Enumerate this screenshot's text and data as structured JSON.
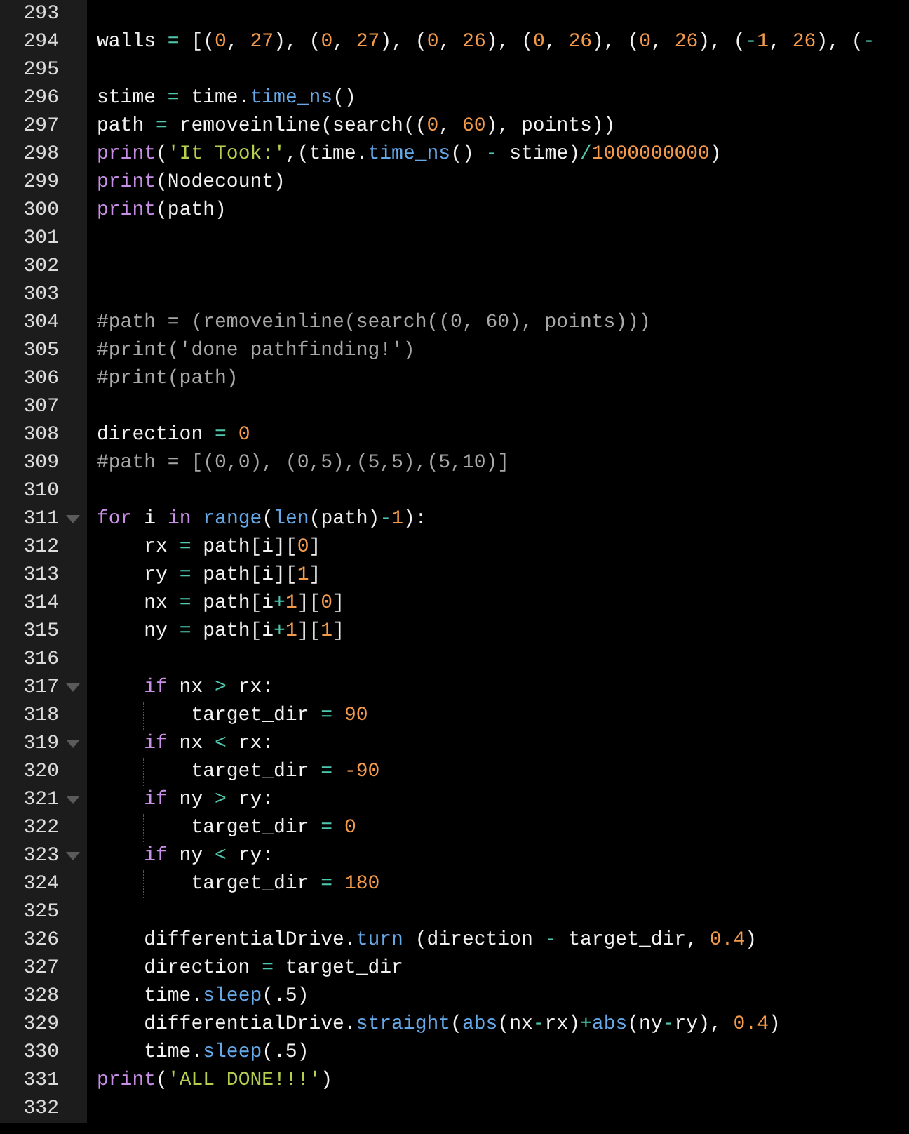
{
  "editor": {
    "lines": [
      {
        "number": "293",
        "fold": false
      },
      {
        "number": "294",
        "fold": false,
        "tokens": [
          {
            "text": "walls ",
            "kind": "plain"
          },
          {
            "text": "=",
            "kind": "operator"
          },
          {
            "text": " [(",
            "kind": "plain"
          },
          {
            "text": "0",
            "kind": "number"
          },
          {
            "text": ", ",
            "kind": "plain"
          },
          {
            "text": "27",
            "kind": "number"
          },
          {
            "text": "), (",
            "kind": "plain"
          },
          {
            "text": "0",
            "kind": "number"
          },
          {
            "text": ", ",
            "kind": "plain"
          },
          {
            "text": "27",
            "kind": "number"
          },
          {
            "text": "), (",
            "kind": "plain"
          },
          {
            "text": "0",
            "kind": "number"
          },
          {
            "text": ", ",
            "kind": "plain"
          },
          {
            "text": "26",
            "kind": "number"
          },
          {
            "text": "), (",
            "kind": "plain"
          },
          {
            "text": "0",
            "kind": "number"
          },
          {
            "text": ", ",
            "kind": "plain"
          },
          {
            "text": "26",
            "kind": "number"
          },
          {
            "text": "), (",
            "kind": "plain"
          },
          {
            "text": "0",
            "kind": "number"
          },
          {
            "text": ", ",
            "kind": "plain"
          },
          {
            "text": "26",
            "kind": "number"
          },
          {
            "text": "), (",
            "kind": "plain"
          },
          {
            "text": "-",
            "kind": "operator"
          },
          {
            "text": "1",
            "kind": "number"
          },
          {
            "text": ", ",
            "kind": "plain"
          },
          {
            "text": "26",
            "kind": "number"
          },
          {
            "text": "), (",
            "kind": "plain"
          },
          {
            "text": "-",
            "kind": "operator"
          }
        ]
      },
      {
        "number": "295",
        "fold": false
      },
      {
        "number": "296",
        "fold": false,
        "tokens": [
          {
            "text": "stime ",
            "kind": "plain"
          },
          {
            "text": "=",
            "kind": "operator"
          },
          {
            "text": " time.",
            "kind": "plain"
          },
          {
            "text": "time_ns",
            "kind": "function"
          },
          {
            "text": "()",
            "kind": "plain"
          }
        ]
      },
      {
        "number": "297",
        "fold": false,
        "tokens": [
          {
            "text": "path ",
            "kind": "plain"
          },
          {
            "text": "=",
            "kind": "operator"
          },
          {
            "text": " removeinline(search((",
            "kind": "plain"
          },
          {
            "text": "0",
            "kind": "number"
          },
          {
            "text": ", ",
            "kind": "plain"
          },
          {
            "text": "60",
            "kind": "number"
          },
          {
            "text": "), points))",
            "kind": "plain"
          }
        ]
      },
      {
        "number": "298",
        "fold": false,
        "tokens": [
          {
            "text": "print",
            "kind": "keyword"
          },
          {
            "text": "(",
            "kind": "plain"
          },
          {
            "text": "'It Took:'",
            "kind": "string"
          },
          {
            "text": ",(time.",
            "kind": "plain"
          },
          {
            "text": "time_ns",
            "kind": "function"
          },
          {
            "text": "() ",
            "kind": "plain"
          },
          {
            "text": "-",
            "kind": "operator"
          },
          {
            "text": " stime)",
            "kind": "plain"
          },
          {
            "text": "/",
            "kind": "operator"
          },
          {
            "text": "1000000000",
            "kind": "number"
          },
          {
            "text": ")",
            "kind": "plain"
          }
        ]
      },
      {
        "number": "299",
        "fold": false,
        "tokens": [
          {
            "text": "print",
            "kind": "keyword"
          },
          {
            "text": "(Nodecount)",
            "kind": "plain"
          }
        ]
      },
      {
        "number": "300",
        "fold": false,
        "tokens": [
          {
            "text": "print",
            "kind": "keyword"
          },
          {
            "text": "(path)",
            "kind": "plain"
          }
        ]
      },
      {
        "number": "301",
        "fold": false
      },
      {
        "number": "302",
        "fold": false
      },
      {
        "number": "303",
        "fold": false
      },
      {
        "number": "304",
        "fold": false,
        "tokens": [
          {
            "text": "#path = (removeinline(search((0, 60), points)))",
            "kind": "comment"
          }
        ]
      },
      {
        "number": "305",
        "fold": false,
        "tokens": [
          {
            "text": "#print('done pathfinding!')",
            "kind": "comment"
          }
        ]
      },
      {
        "number": "306",
        "fold": false,
        "tokens": [
          {
            "text": "#print(path)",
            "kind": "comment"
          }
        ]
      },
      {
        "number": "307",
        "fold": false
      },
      {
        "number": "308",
        "fold": false,
        "tokens": [
          {
            "text": "direction ",
            "kind": "plain"
          },
          {
            "text": "= ",
            "kind": "operator"
          },
          {
            "text": "0",
            "kind": "number"
          }
        ]
      },
      {
        "number": "309",
        "fold": false,
        "tokens": [
          {
            "text": "#path = [(0,0), (0,5),(5,5),(5,10)]",
            "kind": "comment"
          }
        ]
      },
      {
        "number": "310",
        "fold": false
      },
      {
        "number": "311",
        "fold": true,
        "tokens": [
          {
            "text": "for",
            "kind": "keyword"
          },
          {
            "text": " i ",
            "kind": "plain"
          },
          {
            "text": "in ",
            "kind": "keyword"
          },
          {
            "text": "range",
            "kind": "function"
          },
          {
            "text": "(",
            "kind": "plain"
          },
          {
            "text": "len",
            "kind": "function"
          },
          {
            "text": "(path)",
            "kind": "plain"
          },
          {
            "text": "-",
            "kind": "operator"
          },
          {
            "text": "1",
            "kind": "number"
          },
          {
            "text": "):",
            "kind": "plain"
          }
        ]
      },
      {
        "number": "312",
        "fold": false,
        "tokens": [
          {
            "text": "    rx ",
            "kind": "plain"
          },
          {
            "text": "=",
            "kind": "operator"
          },
          {
            "text": " path[i][",
            "kind": "plain"
          },
          {
            "text": "0",
            "kind": "number"
          },
          {
            "text": "]",
            "kind": "plain"
          }
        ]
      },
      {
        "number": "313",
        "fold": false,
        "tokens": [
          {
            "text": "    ry ",
            "kind": "plain"
          },
          {
            "text": "=",
            "kind": "operator"
          },
          {
            "text": " path[i][",
            "kind": "plain"
          },
          {
            "text": "1",
            "kind": "number"
          },
          {
            "text": "]",
            "kind": "plain"
          }
        ]
      },
      {
        "number": "314",
        "fold": false,
        "tokens": [
          {
            "text": "    nx ",
            "kind": "plain"
          },
          {
            "text": "=",
            "kind": "operator"
          },
          {
            "text": " path[i",
            "kind": "plain"
          },
          {
            "text": "+",
            "kind": "operator"
          },
          {
            "text": "1",
            "kind": "number"
          },
          {
            "text": "][",
            "kind": "plain"
          },
          {
            "text": "0",
            "kind": "number"
          },
          {
            "text": "]",
            "kind": "plain"
          }
        ]
      },
      {
        "number": "315",
        "fold": false,
        "tokens": [
          {
            "text": "    ny ",
            "kind": "plain"
          },
          {
            "text": "=",
            "kind": "operator"
          },
          {
            "text": " path[i",
            "kind": "plain"
          },
          {
            "text": "+",
            "kind": "operator"
          },
          {
            "text": "1",
            "kind": "number"
          },
          {
            "text": "][",
            "kind": "plain"
          },
          {
            "text": "1",
            "kind": "number"
          },
          {
            "text": "]",
            "kind": "plain"
          }
        ]
      },
      {
        "number": "316",
        "fold": false
      },
      {
        "number": "317",
        "fold": true,
        "tokens": [
          {
            "text": "    if",
            "kind": "keyword"
          },
          {
            "text": " nx ",
            "kind": "plain"
          },
          {
            "text": ">",
            "kind": "operator"
          },
          {
            "text": " rx:",
            "kind": "plain"
          }
        ]
      },
      {
        "number": "318",
        "fold": false,
        "tokens": [
          {
            "text": "        target_dir ",
            "kind": "plain"
          },
          {
            "text": "= ",
            "kind": "operator"
          },
          {
            "text": "90",
            "kind": "number"
          }
        ]
      },
      {
        "number": "319",
        "fold": true,
        "tokens": [
          {
            "text": "    if",
            "kind": "keyword"
          },
          {
            "text": " nx ",
            "kind": "plain"
          },
          {
            "text": "<",
            "kind": "operator"
          },
          {
            "text": " rx:",
            "kind": "plain"
          }
        ]
      },
      {
        "number": "320",
        "fold": false,
        "tokens": [
          {
            "text": "        target_dir ",
            "kind": "plain"
          },
          {
            "text": "= ",
            "kind": "operator"
          },
          {
            "text": "-90",
            "kind": "number"
          }
        ]
      },
      {
        "number": "321",
        "fold": true,
        "tokens": [
          {
            "text": "    if",
            "kind": "keyword"
          },
          {
            "text": " ny ",
            "kind": "plain"
          },
          {
            "text": ">",
            "kind": "operator"
          },
          {
            "text": " ry:",
            "kind": "plain"
          }
        ]
      },
      {
        "number": "322",
        "fold": false,
        "tokens": [
          {
            "text": "        target_dir ",
            "kind": "plain"
          },
          {
            "text": "= ",
            "kind": "operator"
          },
          {
            "text": "0",
            "kind": "number"
          }
        ]
      },
      {
        "number": "323",
        "fold": true,
        "tokens": [
          {
            "text": "    if",
            "kind": "keyword"
          },
          {
            "text": " ny ",
            "kind": "plain"
          },
          {
            "text": "<",
            "kind": "operator"
          },
          {
            "text": " ry:",
            "kind": "plain"
          }
        ]
      },
      {
        "number": "324",
        "fold": false,
        "tokens": [
          {
            "text": "        target_dir ",
            "kind": "plain"
          },
          {
            "text": "= ",
            "kind": "operator"
          },
          {
            "text": "180",
            "kind": "number"
          }
        ]
      },
      {
        "number": "325",
        "fold": false
      },
      {
        "number": "326",
        "fold": false,
        "tokens": [
          {
            "text": "    differentialDrive.",
            "kind": "plain"
          },
          {
            "text": "turn",
            "kind": "function"
          },
          {
            "text": " (direction ",
            "kind": "plain"
          },
          {
            "text": "-",
            "kind": "operator"
          },
          {
            "text": " target_dir, ",
            "kind": "plain"
          },
          {
            "text": "0.4",
            "kind": "number"
          },
          {
            "text": ")",
            "kind": "plain"
          }
        ]
      },
      {
        "number": "327",
        "fold": false,
        "tokens": [
          {
            "text": "    direction ",
            "kind": "plain"
          },
          {
            "text": "=",
            "kind": "operator"
          },
          {
            "text": " target_dir",
            "kind": "plain"
          }
        ]
      },
      {
        "number": "328",
        "fold": false,
        "tokens": [
          {
            "text": "    time.",
            "kind": "plain"
          },
          {
            "text": "sleep",
            "kind": "function"
          },
          {
            "text": "(.5)",
            "kind": "plain"
          }
        ]
      },
      {
        "number": "329",
        "fold": false,
        "tokens": [
          {
            "text": "    differentialDrive.",
            "kind": "plain"
          },
          {
            "text": "straight",
            "kind": "function"
          },
          {
            "text": "(",
            "kind": "plain"
          },
          {
            "text": "abs",
            "kind": "function"
          },
          {
            "text": "(nx",
            "kind": "plain"
          },
          {
            "text": "-",
            "kind": "operator"
          },
          {
            "text": "rx)",
            "kind": "plain"
          },
          {
            "text": "+",
            "kind": "operator"
          },
          {
            "text": "abs",
            "kind": "function"
          },
          {
            "text": "(ny",
            "kind": "plain"
          },
          {
            "text": "-",
            "kind": "operator"
          },
          {
            "text": "ry), ",
            "kind": "plain"
          },
          {
            "text": "0.4",
            "kind": "number"
          },
          {
            "text": ")",
            "kind": "plain"
          }
        ]
      },
      {
        "number": "330",
        "fold": false,
        "tokens": [
          {
            "text": "    time.",
            "kind": "plain"
          },
          {
            "text": "sleep",
            "kind": "function"
          },
          {
            "text": "(.5)",
            "kind": "plain"
          }
        ]
      },
      {
        "number": "331",
        "fold": false,
        "tokens": [
          {
            "text": "print",
            "kind": "keyword"
          },
          {
            "text": "(",
            "kind": "plain"
          },
          {
            "text": "'ALL DONE!!!'",
            "kind": "string"
          },
          {
            "text": ")",
            "kind": "plain"
          }
        ]
      },
      {
        "number": "332",
        "fold": false
      }
    ]
  }
}
